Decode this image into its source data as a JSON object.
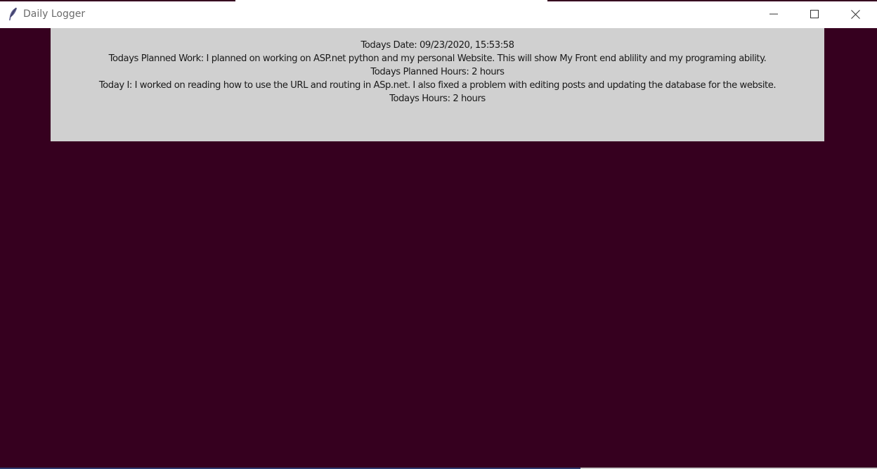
{
  "window": {
    "title": "Daily Logger",
    "icon": "feather-icon",
    "controls": {
      "minimize_icon": "minimize-icon",
      "maximize_icon": "maximize-icon",
      "close_icon": "close-icon"
    }
  },
  "colors": {
    "background": "#36001f",
    "panel": "#d0d0d0",
    "titlebar": "#ffffff",
    "text": "#1a1a1a"
  },
  "log": {
    "date_line": "Todays Date: 09/23/2020, 15:53:58",
    "planned_work_line": "Todays Planned Work: I planned on working on ASP.net python and my personal Website. This will show My Front end ablility and my programing ability.",
    "planned_hours_line": "Todays Planned Hours: 2 hours",
    "today_line": "Today I: I worked on reading how to use the URL and routing in ASp.net. I also fixed a problem with editing posts and updating the database for the website.",
    "hours_line": "Todays Hours: 2 hours"
  }
}
